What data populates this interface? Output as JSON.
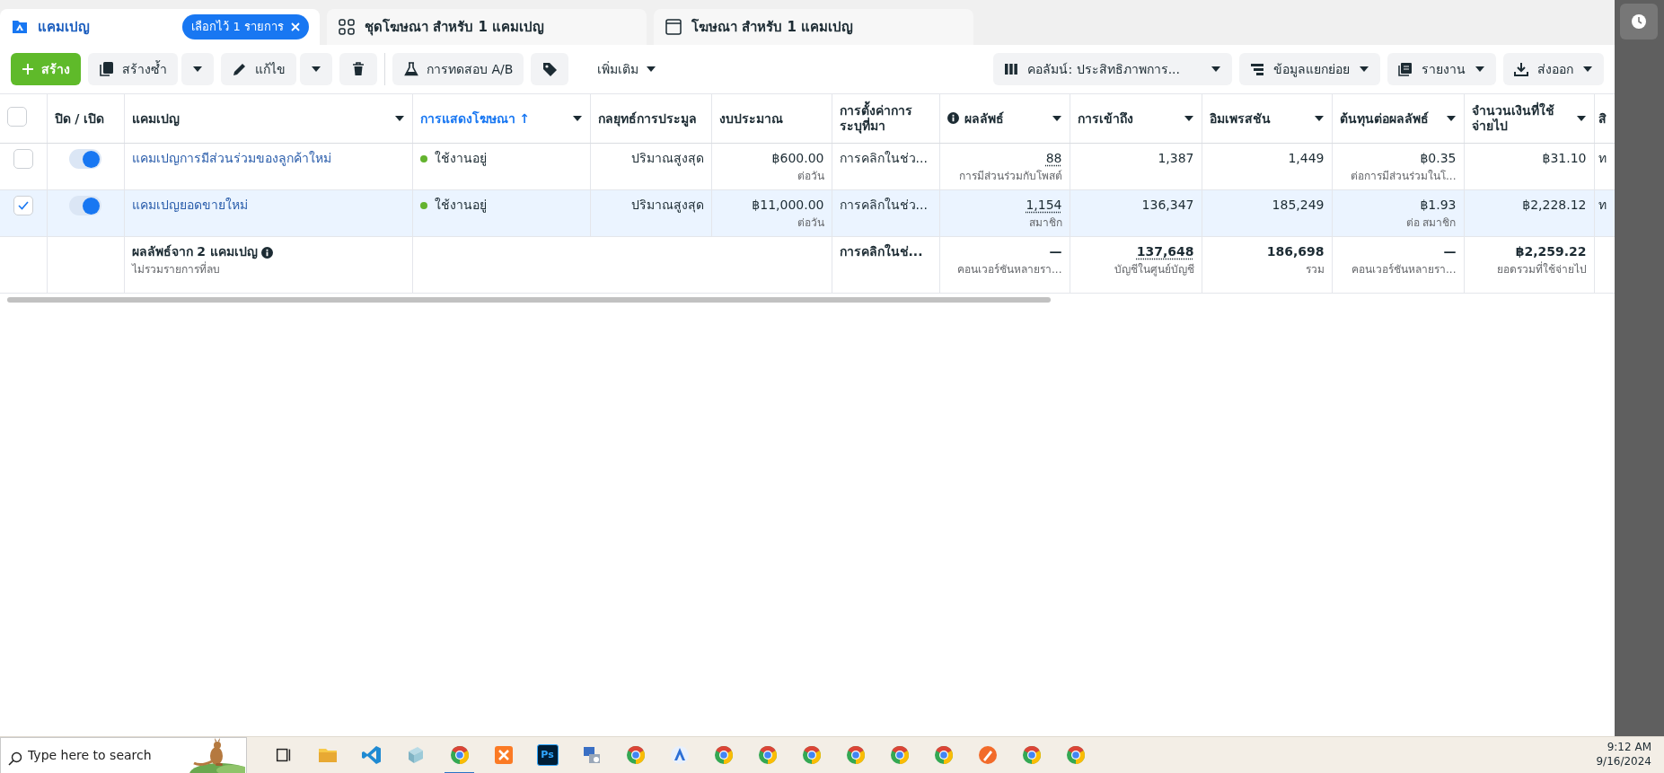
{
  "tabs": [
    {
      "label": "แคมเปญ",
      "selected": true,
      "badge": "เลือกไว้ 1 รายการ"
    },
    {
      "label": "ชุดโฆษณา สำหรับ 1 แคมเปญ",
      "selected": false
    },
    {
      "label": "โฆษณา สำหรับ 1 แคมเปญ",
      "selected": false
    }
  ],
  "toolbar": {
    "left": [
      {
        "kind": "create",
        "label": "สร้าง"
      },
      {
        "kind": "duplicate",
        "label": "สร้างซ้ำ"
      },
      {
        "kind": "edit",
        "label": "แก้ไข"
      },
      {
        "kind": "delete"
      },
      {
        "kind": "divider"
      },
      {
        "kind": "ab_test",
        "label": "การทดสอบ A/B"
      },
      {
        "kind": "tags"
      },
      {
        "kind": "more",
        "label": "เพิ่มเติม"
      }
    ],
    "right": [
      {
        "label": "คอลัมน์: ประสิทธิภาพการ..."
      },
      {
        "label": "ข้อมูลแยกย่อย"
      },
      {
        "label": "รายงาน"
      },
      {
        "label": "ส่งออก"
      }
    ]
  },
  "table": {
    "columns": [
      {
        "kind": "checkbox",
        "checked": false
      },
      {
        "kind": "text",
        "label": "ปิด / เปิด",
        "menu": false
      },
      {
        "kind": "text",
        "label": "แคมเปญ",
        "menu": true
      },
      {
        "kind": "text",
        "label": "การแสดงโฆษณา ↑",
        "menu": true,
        "sorted": true
      },
      {
        "kind": "text",
        "label": "กลยุทธ์การประมูล",
        "menu": false
      },
      {
        "kind": "text",
        "label": "งบประมาณ",
        "menu": false
      },
      {
        "kind": "text",
        "label": "การตั้งค่าการระบุที่มา",
        "menu": false
      },
      {
        "kind": "text",
        "label": "ผลลัพธ์",
        "menu": true,
        "info": true
      },
      {
        "kind": "text",
        "label": "การเข้าถึง",
        "menu": true
      },
      {
        "kind": "text",
        "label": "อิมเพรสชัน",
        "menu": true
      },
      {
        "kind": "text",
        "label": "ต้นทุนต่อผลลัพธ์",
        "menu": true
      },
      {
        "kind": "text",
        "label": "จำนวนเงินที่ใช้จ่ายไป",
        "menu": true
      },
      {
        "kind": "text",
        "label": "สิ",
        "menu": false
      }
    ],
    "rows": [
      {
        "cells": [
          {
            "kind": "checkbox",
            "selected": false
          },
          {
            "kind": "toggle",
            "on": true
          },
          {
            "text": "แคมเปญการมีส่วนร่วมของลูกค้าใหม่",
            "link": true
          },
          {
            "text": "ใช้งานอยู่",
            "color": "#63b32e"
          },
          {
            "text": "ปริมาณสูงสุด"
          },
          {
            "text": "฿600.00",
            "sub": "ต่อวัน"
          },
          {
            "text": "การคลิกในช่ว..."
          },
          {
            "text": "88",
            "sub": "การมีส่วนร่วมกับโพสต์",
            "underlined": true
          },
          {
            "text": "1,387"
          },
          {
            "text": "1,449"
          },
          {
            "text": "฿0.35",
            "sub": "ต่อการมีส่วนร่วมในโ..."
          },
          {
            "text": "฿31.10"
          },
          {
            "text": "ท"
          }
        ]
      },
      {
        "cells": [
          {
            "kind": "checkbox",
            "selected": true
          },
          {
            "kind": "toggle",
            "on": true
          },
          {
            "text": "แคมเปญยอดขายใหม่",
            "link": true
          },
          {
            "text": "ใช้งานอยู่",
            "color": "#63b32e"
          },
          {
            "text": "ปริมาณสูงสุด"
          },
          {
            "text": "฿11,000.00",
            "sub": "ต่อวัน"
          },
          {
            "text": "การคลิกในช่ว..."
          },
          {
            "text": "1,154",
            "sub": "สมาชิก",
            "underlined": true
          },
          {
            "text": "136,347"
          },
          {
            "text": "185,249"
          },
          {
            "text": "฿1.93",
            "sub": "ต่อ สมาชิก"
          },
          {
            "text": "฿2,228.12"
          },
          {
            "text": "ท"
          }
        ]
      }
    ],
    "summary": {
      "cells": [
        "",
        "",
        {
          "text": "ผลลัพธ์จาก 2 แคมเปญ",
          "sub": "ไม่รวมรายการที่ลบ",
          "info": true
        },
        "",
        "",
        "",
        {
          "text": "การคลิกในช่..."
        },
        {
          "text": "—",
          "sub": "คอนเวอร์ชันหลายรา..."
        },
        {
          "text": "137,648",
          "sub": "บัญชีในศูนย์บัญชี",
          "underlined": true
        },
        {
          "text": "186,698",
          "sub": "รวม"
        },
        {
          "text": "—",
          "sub": "คอนเวอร์ชันหลายรา..."
        },
        {
          "text": "฿2,259.22",
          "sub": "ยอดรวมที่ใช้จ่ายไป"
        },
        ""
      ]
    }
  },
  "taskbar": {
    "search": {
      "placeholder": "Type here to search"
    },
    "apps": [
      {
        "kind": "taskview",
        "active": false
      },
      {
        "kind": "folder",
        "active": false
      },
      {
        "kind": "vscode",
        "active": false
      },
      {
        "kind": "app",
        "active": false
      },
      {
        "kind": "chrome",
        "active": true
      },
      {
        "kind": "xampp",
        "active": false
      },
      {
        "kind": "photoshop",
        "label": "Ps",
        "active": false
      },
      {
        "kind": "network",
        "active": false
      },
      {
        "kind": "chrome",
        "active": false
      },
      {
        "kind": "compass",
        "active": false
      },
      {
        "kind": "chrome",
        "active": false
      },
      {
        "kind": "chrome",
        "active": false
      },
      {
        "kind": "chrome",
        "active": false
      },
      {
        "kind": "chrome",
        "active": false
      },
      {
        "kind": "chrome",
        "active": false
      },
      {
        "kind": "chrome",
        "active": false
      },
      {
        "kind": "pen",
        "active": false
      },
      {
        "kind": "chrome",
        "active": false
      },
      {
        "kind": "chrome",
        "active": false
      }
    ],
    "time": "9:12 AM",
    "date": "9/16/2024"
  }
}
